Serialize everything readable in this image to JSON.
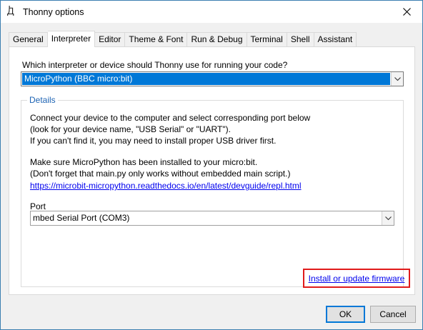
{
  "window": {
    "title": "Thonny options",
    "app_icon_glyph": "Ꚁ",
    "close_glyph": "✕"
  },
  "tabs": [
    {
      "label": "General",
      "active": false
    },
    {
      "label": "Interpreter",
      "active": true
    },
    {
      "label": "Editor",
      "active": false
    },
    {
      "label": "Theme & Font",
      "active": false
    },
    {
      "label": "Run & Debug",
      "active": false
    },
    {
      "label": "Terminal",
      "active": false
    },
    {
      "label": "Shell",
      "active": false
    },
    {
      "label": "Assistant",
      "active": false
    }
  ],
  "interpreter": {
    "question": "Which interpreter or device should Thonny use for running your code?",
    "selected": "MicroPython (BBC micro:bit)"
  },
  "details": {
    "legend": "Details",
    "line1": "Connect your device to the computer and select corresponding port below",
    "line2": "(look for your device name, \"USB Serial\" or \"UART\").",
    "line3": "If you can't find it, you may need to install proper USB driver first.",
    "line4": "Make sure MicroPython has been installed to your micro:bit.",
    "line5": "(Don't forget that main.py only works without embedded main script.)",
    "doc_link": "https://microbit-micropython.readthedocs.io/en/latest/devguide/repl.html",
    "port_label": "Port",
    "port_selected": "mbed Serial Port (COM3)",
    "firmware_link": "Install or update firmware"
  },
  "buttons": {
    "ok": "OK",
    "cancel": "Cancel"
  },
  "colors": {
    "accent": "#0078d7",
    "link": "#0000ee",
    "highlight_box": "#e01b1b",
    "legend": "#1e64b4"
  }
}
